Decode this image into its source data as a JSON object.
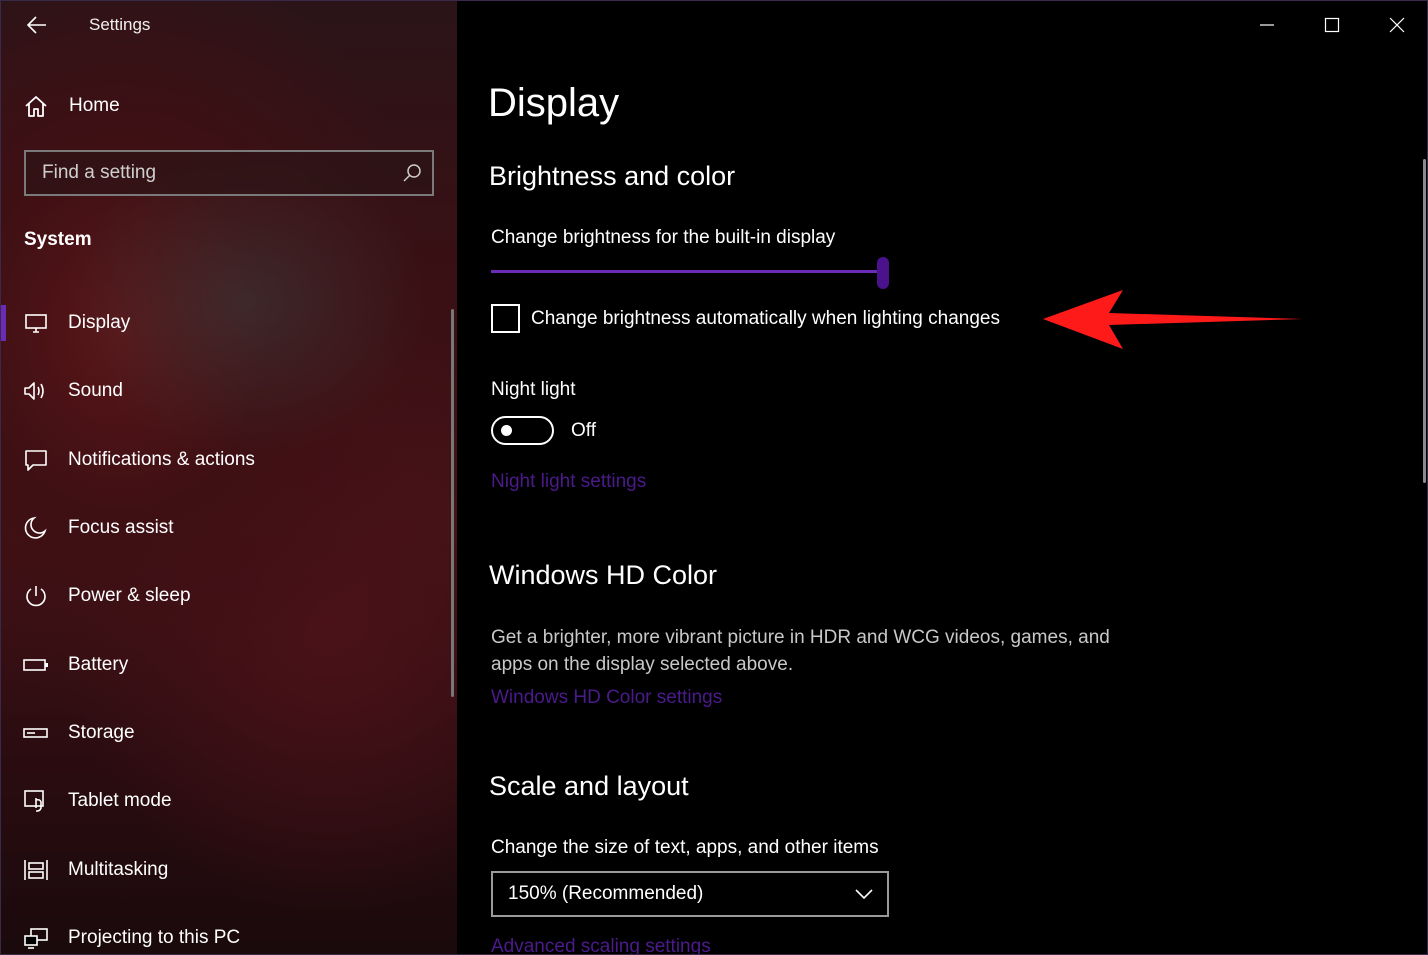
{
  "window": {
    "title": "Settings"
  },
  "sidebar": {
    "home_label": "Home",
    "search_placeholder": "Find a setting",
    "section": "System",
    "items": [
      {
        "label": "Display",
        "icon": "monitor-icon",
        "active": true
      },
      {
        "label": "Sound",
        "icon": "speaker-icon"
      },
      {
        "label": "Notifications & actions",
        "icon": "notification-icon"
      },
      {
        "label": "Focus assist",
        "icon": "moon-icon"
      },
      {
        "label": "Power & sleep",
        "icon": "power-icon"
      },
      {
        "label": "Battery",
        "icon": "battery-icon"
      },
      {
        "label": "Storage",
        "icon": "storage-icon"
      },
      {
        "label": "Tablet mode",
        "icon": "tablet-mode-icon"
      },
      {
        "label": "Multitasking",
        "icon": "multitasking-icon"
      },
      {
        "label": "Projecting to this PC",
        "icon": "projecting-icon"
      }
    ]
  },
  "main": {
    "title": "Display",
    "brightness": {
      "heading": "Brightness and color",
      "slider_label": "Change brightness for the built-in display",
      "slider_value": 1.0,
      "auto_label": "Change brightness automatically when lighting changes",
      "auto_checked": false
    },
    "night_light": {
      "label": "Night light",
      "state": "Off",
      "settings_link": "Night light settings"
    },
    "hd_color": {
      "heading": "Windows HD Color",
      "description": "Get a brighter, more vibrant picture in HDR and WCG videos, games, and apps on the display selected above.",
      "settings_link": "Windows HD Color settings"
    },
    "scale": {
      "heading": "Scale and layout",
      "size_label": "Change the size of text, apps, and other items",
      "size_value": "150% (Recommended)",
      "advanced_link": "Advanced scaling settings"
    }
  },
  "colors": {
    "accent": "#6b2bb8",
    "link": "#4b1a8c",
    "annotation": "#ff1a1a"
  }
}
